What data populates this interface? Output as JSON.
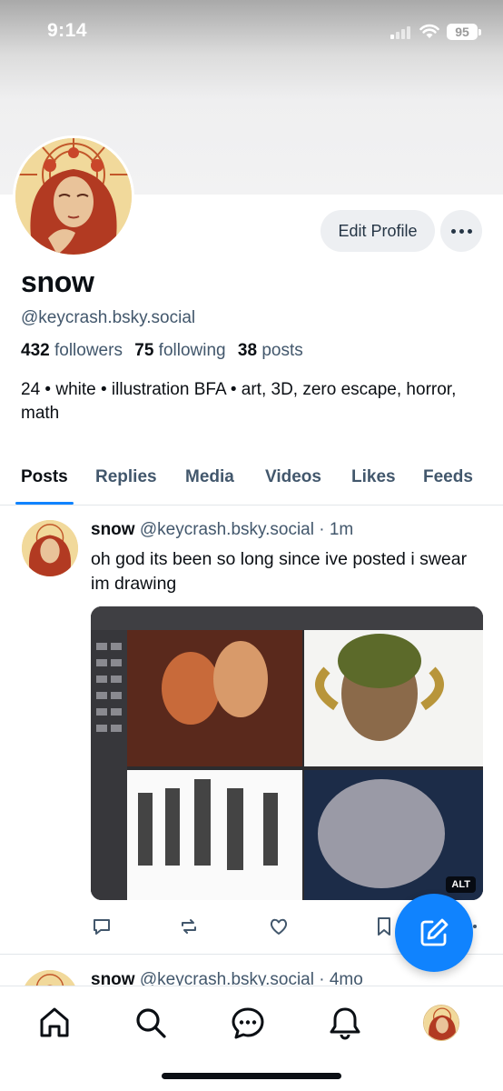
{
  "status_bar": {
    "time": "9:14",
    "battery": "95",
    "icons": [
      "signal-icon",
      "wifi-icon",
      "battery-icon"
    ]
  },
  "profile": {
    "display_name": "snow",
    "handle": "@keycrash.bsky.social",
    "followers_count": "432",
    "followers_label": "followers",
    "following_count": "75",
    "following_label": "following",
    "posts_count": "38",
    "posts_label": "posts",
    "bio": "24 • white • illustration BFA • art, 3D, zero escape, horror, math",
    "edit_button": "Edit Profile",
    "more_icon": "ellipsis-icon"
  },
  "tabs": [
    {
      "label": "Posts",
      "active": true
    },
    {
      "label": "Replies",
      "active": false
    },
    {
      "label": "Media",
      "active": false
    },
    {
      "label": "Videos",
      "active": false
    },
    {
      "label": "Likes",
      "active": false
    },
    {
      "label": "Feeds",
      "active": false
    }
  ],
  "posts": [
    {
      "author_name": "snow",
      "author_handle": "@keycrash.bsky.social",
      "separator": "·",
      "time": "1m",
      "text": "oh god its been so long since ive posted i swear im drawing",
      "image_alt_badge": "ALT",
      "actions": [
        "reply-icon",
        "repost-icon",
        "like-icon",
        "bookmark-icon",
        "more-icon"
      ]
    },
    {
      "author_name": "snow",
      "author_handle": "@keycrash.bsky.social",
      "separator": "·",
      "time": "4mo"
    }
  ],
  "fab": {
    "icon": "compose-icon"
  },
  "bottom_nav": [
    "home-icon",
    "search-icon",
    "chat-icon",
    "notifications-icon",
    "profile-avatar"
  ],
  "colors": {
    "accent": "#1083fe",
    "text": "#0b0f14",
    "muted": "#42576c",
    "button_bg": "#edeff2"
  }
}
